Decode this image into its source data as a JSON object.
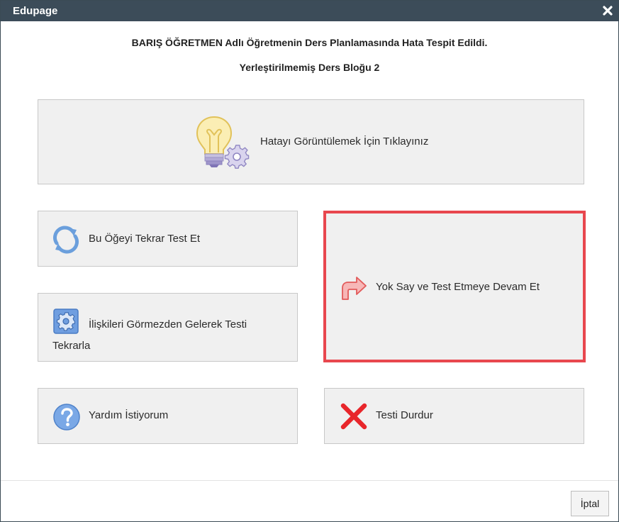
{
  "window": {
    "title": "Edupage",
    "close_icon": "close-icon"
  },
  "message": {
    "line1": "BARIŞ ÖĞRETMEN Adlı Öğretmenin Ders Planlamasında Hata Tespit Edildi.",
    "line2": "Yerleştirilmemiş Ders Bloğu 2"
  },
  "actions": {
    "view_error": {
      "label": "Hatayı Görüntülemek İçin Tıklayınız",
      "icon": "lightbulb-gear-icon"
    },
    "retest_item": {
      "label": "Bu Öğeyi Tekrar Test Et",
      "icon": "refresh-icon"
    },
    "retest_ignore_relations": {
      "label": "İlişkileri Görmezden Gelerek Testi Tekrarla",
      "icon": "settings-gear-icon"
    },
    "skip_continue": {
      "label": "Yok Say ve Test Etmeye Devam Et",
      "icon": "turn-right-arrow-icon"
    },
    "help": {
      "label": "Yardım İstiyorum",
      "icon": "help-question-icon"
    },
    "stop_test": {
      "label": "Testi Durdur",
      "icon": "red-x-icon"
    }
  },
  "footer": {
    "cancel_label": "İptal"
  },
  "colors": {
    "titlebar": "#3c4c59",
    "highlight_border": "#e8474e",
    "button_bg": "#f0f0f0"
  }
}
